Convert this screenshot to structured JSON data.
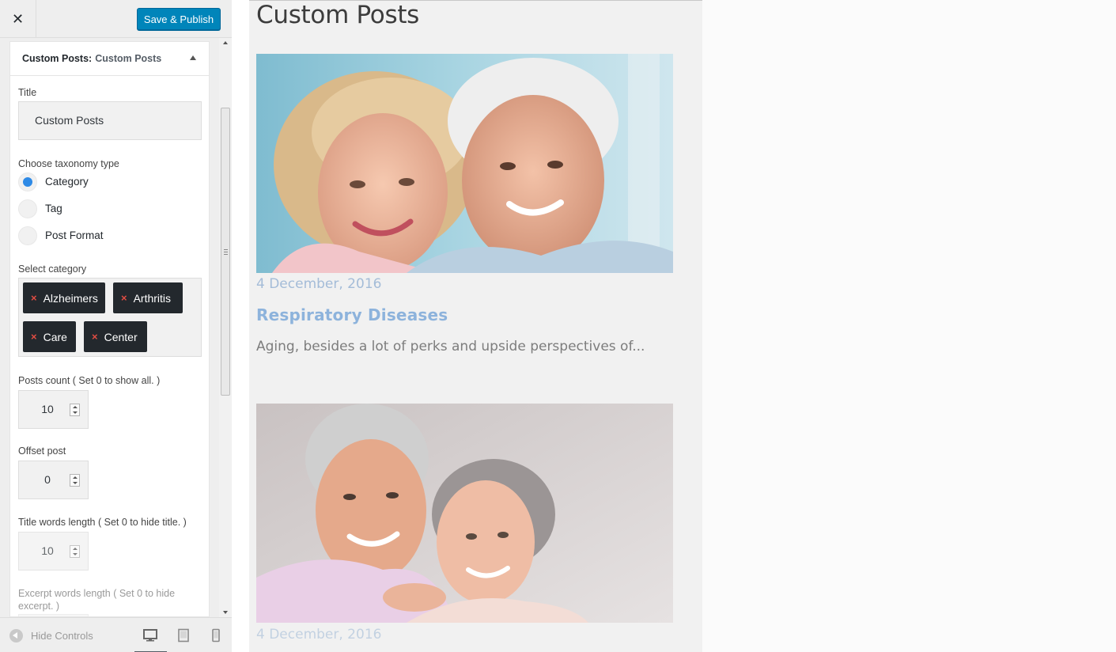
{
  "header": {
    "close_icon": "close-icon",
    "publish_label": "Save & Publish"
  },
  "widget": {
    "type_label": "Custom Posts:",
    "instance_title": "Custom Posts",
    "title_field_label": "Title",
    "title_value": "Custom Posts",
    "taxonomy_label": "Choose taxonomy type",
    "taxonomy_options": [
      "Category",
      "Tag",
      "Post Format"
    ],
    "taxonomy_selected": "Category",
    "category_label": "Select category",
    "categories": [
      "Alzheimers",
      "Arthritis",
      "Care",
      "Center"
    ],
    "chip_remove": "×",
    "posts_count_label": "Posts count ( Set 0 to show all. )",
    "posts_count_value": "10",
    "offset_label": "Offset post",
    "offset_value": "0",
    "title_words_label": "Title words length ( Set 0 to hide title. )",
    "title_words_value": "10",
    "excerpt_words_label": "Excerpt words length ( Set 0 to hide excerpt. )"
  },
  "footer": {
    "hide_controls_label": "Hide Controls",
    "devices": [
      "desktop-icon",
      "tablet-icon",
      "mobile-icon"
    ]
  },
  "preview": {
    "widget_title": "Custom Posts",
    "posts": [
      {
        "date": "4 December, 2016",
        "title": "Respiratory Diseases",
        "excerpt": "Aging, besides a lot of perks and upside perspectives of..."
      },
      {
        "date": "4 December, 2016"
      }
    ]
  },
  "colors": {
    "publish_button": "#0085ba",
    "chip_background": "#23282d",
    "chip_remove": "#e14d43",
    "radio_checked": "#2e8ae6",
    "post_title": "#8db3dc",
    "post_date": "#a4bcd8"
  }
}
